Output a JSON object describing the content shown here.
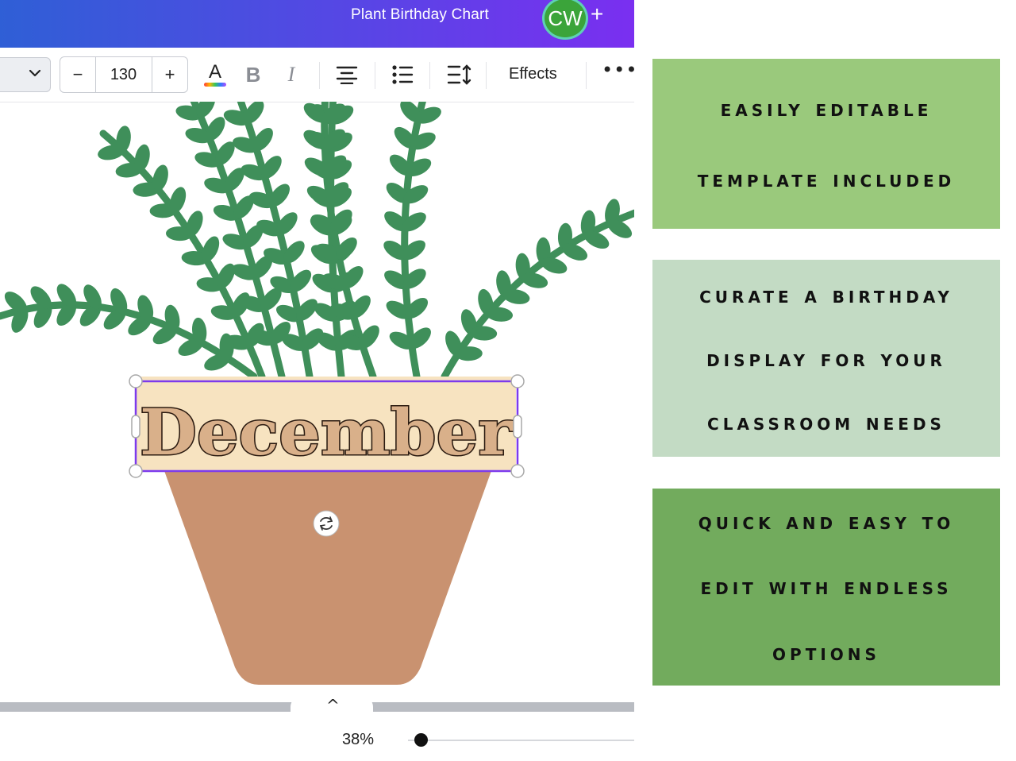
{
  "app": {
    "document_title": "Plant Birthday Chart",
    "avatar_initials": "CW",
    "add_label": "+"
  },
  "toolbar": {
    "font_size_decrease": "−",
    "font_size": "130",
    "font_size_increase": "+",
    "text_color_glyph": "A",
    "bold_glyph": "B",
    "italic_glyph": "I",
    "effects_label": "Effects",
    "more_label": "•••"
  },
  "canvas": {
    "selected_text": "December",
    "colors": {
      "leaf": "#3f8f5a",
      "pot": "#c99270",
      "label_bg": "#f7e3c0",
      "selection": "#7c3aed"
    }
  },
  "footer": {
    "expand_glyph": "^",
    "zoom_label": "38%",
    "zoom_level": 0.38
  },
  "promo": {
    "panels": [
      {
        "lines": [
          "Easily editable",
          "template included"
        ],
        "color": "#9ac97c"
      },
      {
        "lines": [
          "Curate a birthday",
          "display for your",
          "classroom needs"
        ],
        "color": "#c3dbc4"
      },
      {
        "lines": [
          "Quick and easy to",
          "edit with endless",
          "options"
        ],
        "color": "#72ab5d"
      }
    ]
  }
}
